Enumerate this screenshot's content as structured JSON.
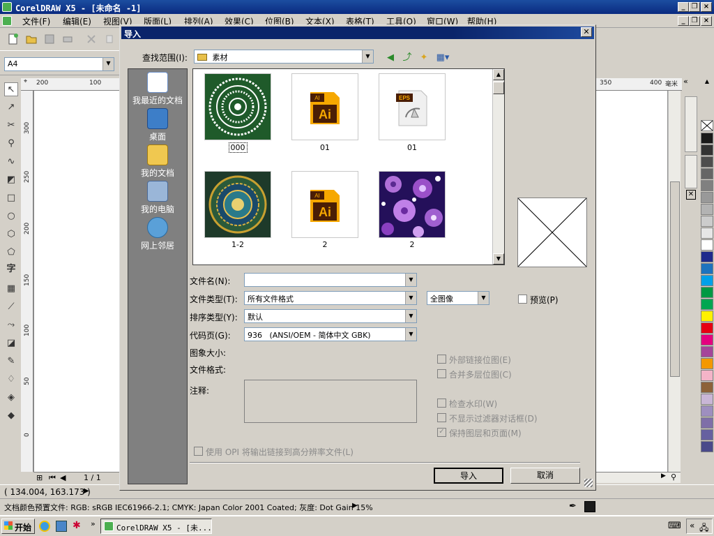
{
  "app": {
    "title": "CorelDRAW X5 - [未命名 -1]",
    "menu": [
      "文件(F)",
      "编辑(E)",
      "视图(V)",
      "版面(L)",
      "排列(A)",
      "效果(C)",
      "位图(B)",
      "文本(X)",
      "表格(T)",
      "工具(O)",
      "窗口(W)",
      "帮助(H)"
    ],
    "page_size": "A4",
    "ruler_top": [
      "200",
      "100",
      "350",
      "400"
    ],
    "ruler_unit": "毫米",
    "ruler_left": [
      "300",
      "250",
      "200",
      "150",
      "100",
      "50",
      "0"
    ],
    "page_counter": "1 / 1",
    "coords": "( 134.004, 163.173 )",
    "color_profile": "文档颜色预置文件: RGB: sRGB IEC61966-2.1; CMYK: Japan Color 2001 Coated; 灰度: Dot Gain 15%",
    "palette": [
      "#1a1a1a",
      "#333333",
      "#4d4d4d",
      "#666666",
      "#808080",
      "#999999",
      "#b3b3b3",
      "#cccccc",
      "#e6e6e6",
      "#ffffff",
      "#1f2a8c",
      "#1e73be",
      "#00a0e9",
      "#009944",
      "#00a651",
      "#fff100",
      "#e60012",
      "#e4007f",
      "#a5449a",
      "#f39800",
      "#f4b4c8",
      "#8c6239",
      "#c9b6d6",
      "#9e8fbf",
      "#7f6fa8",
      "#6660a0",
      "#4a4a8a"
    ]
  },
  "taskbar": {
    "start": "开始",
    "task": "CorelDRAW X5 - [未..."
  },
  "dialog": {
    "title": "导入",
    "look_in_label": "查找范围(I):",
    "look_in_value": "素材",
    "places": [
      "我最近的文档",
      "桌面",
      "我的文档",
      "我的电脑",
      "网上邻居"
    ],
    "files": [
      {
        "name": "000",
        "kind": "pattern-green"
      },
      {
        "name": "01",
        "kind": "ai"
      },
      {
        "name": "01",
        "kind": "eps"
      },
      {
        "name": "1-2",
        "kind": "pattern-gold"
      },
      {
        "name": "2",
        "kind": "ai"
      },
      {
        "name": "2",
        "kind": "flowers"
      }
    ],
    "filename_label": "文件名(N):",
    "filename_value": "",
    "filetype_label": "文件类型(T):",
    "filetype_value": "所有文件格式",
    "image_mode_value": "全图像",
    "sort_label": "排序类型(Y):",
    "sort_value": "默认",
    "codepage_label": "代码页(G):",
    "codepage_value": "936   (ANSI/OEM - 简体中文 GBK)",
    "image_size_label": "图象大小:",
    "file_format_label": "文件格式:",
    "notes_label": "注释:",
    "preview_label": "预览(P)",
    "opt_external_link": "外部链接位图(E)",
    "opt_merge_layers": "合并多层位图(C)",
    "opt_watermark": "检查水印(W)",
    "opt_no_filter_dialog": "不显示过滤器对话框(D)",
    "opt_keep_layers": "保持图层和页面(M)",
    "opt_opi": "使用 OPI 将输出链接到高分辨率文件(L)",
    "import_button": "导入",
    "cancel_button": "取消"
  }
}
